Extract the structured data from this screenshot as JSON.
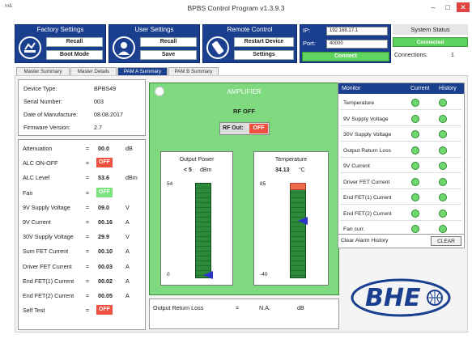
{
  "window": {
    "app_tag": "m&",
    "title": "BPBS Control Program v1.3.9.3",
    "min": "–",
    "max": "□",
    "close": "✕"
  },
  "factory": {
    "title": "Factory Settings",
    "recall": "Recall",
    "boot": "Boot Mode"
  },
  "user": {
    "title": "User Settings",
    "recall": "Recall",
    "save": "Save"
  },
  "remote": {
    "title": "Remote Control",
    "restart": "Restart Device",
    "settings": "Settings"
  },
  "connection": {
    "ip_label": "IP:",
    "ip": "192.168.17.1",
    "port_label": "Port:",
    "port": "40000",
    "connect": "Connect"
  },
  "status": {
    "title": "System Status",
    "state": "Connected",
    "conn_label": "Connections:",
    "conn_count": "1"
  },
  "tabs": [
    "Master Summary",
    "Master Details",
    "PAM A Summary",
    "PAM B Summary"
  ],
  "device": {
    "rows": [
      {
        "label": "Device Type:",
        "value": "BPBS49"
      },
      {
        "label": "Serial Number:",
        "value": "003"
      },
      {
        "label": "Date of Manufacture:",
        "value": "08.08.2017"
      },
      {
        "label": "Firmware Version:",
        "value": "2.7"
      }
    ]
  },
  "params": [
    {
      "label": "Attenuation",
      "eq": "=",
      "value": "00.0",
      "unit": "dB"
    },
    {
      "label": "ALC ON-OFF",
      "eq": "=",
      "value": "OFF",
      "unit": "",
      "badge": "off"
    },
    {
      "label": "ALC Level",
      "eq": "=",
      "value": "53.6",
      "unit": "dBm"
    },
    {
      "label": "Fan",
      "eq": "=",
      "value": "OFF",
      "unit": "",
      "badge": "on"
    },
    {
      "label": "9V Supply Voltage",
      "eq": "=",
      "value": "09.0",
      "unit": "V"
    },
    {
      "label": "9V Current",
      "eq": "=",
      "value": "00.16",
      "unit": "A"
    },
    {
      "label": "30V Supply Voltage",
      "eq": "=",
      "value": "29.9",
      "unit": "V"
    },
    {
      "label": "Sum FET Current",
      "eq": "=",
      "value": "00.10",
      "unit": "A"
    },
    {
      "label": "Driver FET Current",
      "eq": "=",
      "value": "00.03",
      "unit": "A"
    },
    {
      "label": "End FET(1) Current",
      "eq": "=",
      "value": "00.02",
      "unit": "A"
    },
    {
      "label": "End FET(2) Current",
      "eq": "=",
      "value": "00.05",
      "unit": "A"
    },
    {
      "label": "Self Test",
      "eq": "=",
      "value": "OFF",
      "unit": "",
      "badge": "off"
    }
  ],
  "amplifier": {
    "title": "AMPLIFIER",
    "rf_state": "RF OFF",
    "rf_out_label": "RF Out:",
    "rf_out": "OFF",
    "power": {
      "title": "Output Power",
      "prefix": "< 5",
      "unit": "dBm",
      "max": "54",
      "min": "0",
      "level": 0.03
    },
    "temp": {
      "title": "Temperature",
      "value": "34.13",
      "unit": "°C",
      "max": "85",
      "min": "-40",
      "level": 0.6,
      "alarm_zone": 0.08
    }
  },
  "return_loss": {
    "label": "Output Return Loss",
    "eq": "=",
    "value": "N.A.",
    "unit": "dB"
  },
  "monitor": {
    "title": "Monitor",
    "col_current": "Current",
    "col_history": "History",
    "items": [
      "Temperature",
      "9V Supply Voltage",
      "30V Supply Voltage",
      "Output Return Loss",
      "9V Current",
      "Driver FET Current",
      "End FET(1) Current",
      "End FET(2) Current",
      "Fan curr."
    ],
    "clear_label": "Clear Alarm History",
    "clear_button": "CLEAR"
  },
  "logo": {
    "text": "BHE"
  },
  "colors": {
    "accent": "#1a3f8f",
    "ok": "#6fd86f",
    "alarm": "#f0503f"
  }
}
